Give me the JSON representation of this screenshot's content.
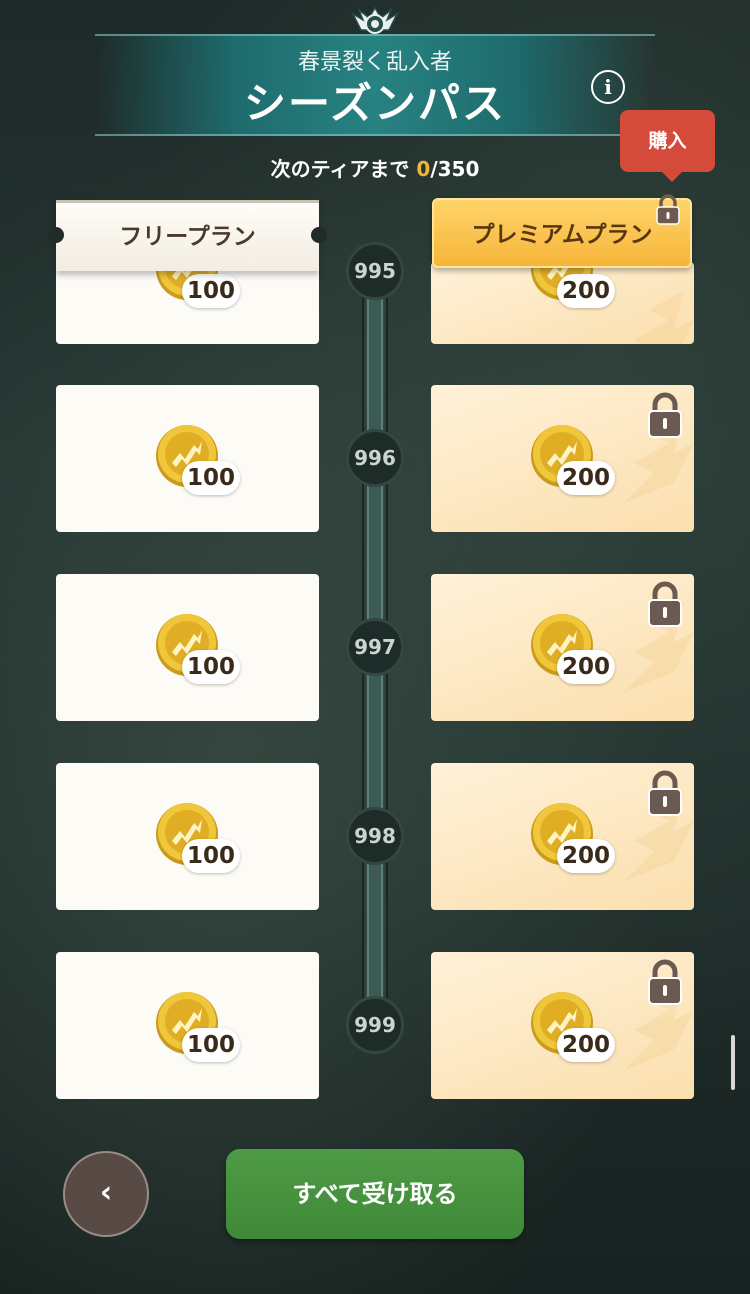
{
  "header": {
    "subtitle": "春景裂く乱入者",
    "title": "シーズンパス",
    "info_icon": "info-icon",
    "emblem_icon": "emblem-icon"
  },
  "progress": {
    "label": "次のティアまで",
    "current": "0",
    "separator_total": "/350"
  },
  "buy_tooltip": "購入",
  "plans": {
    "free_label": "フリープラン",
    "premium_label": "プレミアムプラン",
    "premium_locked": true
  },
  "tiers": [
    {
      "number": "995",
      "free_amount": "100",
      "premium_amount": "200",
      "premium_locked": false
    },
    {
      "number": "996",
      "free_amount": "100",
      "premium_amount": "200",
      "premium_locked": true
    },
    {
      "number": "997",
      "free_amount": "100",
      "premium_amount": "200",
      "premium_locked": true
    },
    {
      "number": "998",
      "free_amount": "100",
      "premium_amount": "200",
      "premium_locked": true
    },
    {
      "number": "999",
      "free_amount": "100",
      "premium_amount": "200",
      "premium_locked": true
    }
  ],
  "buttons": {
    "back_icon": "chevron-left-icon",
    "back_glyph": "‹",
    "claim_all": "すべて受け取る"
  },
  "colors": {
    "accent_gold": "#f2b533",
    "buy_red": "#d44a3b",
    "claim_green": "#4a9441",
    "banner_teal": "#2a8282"
  }
}
